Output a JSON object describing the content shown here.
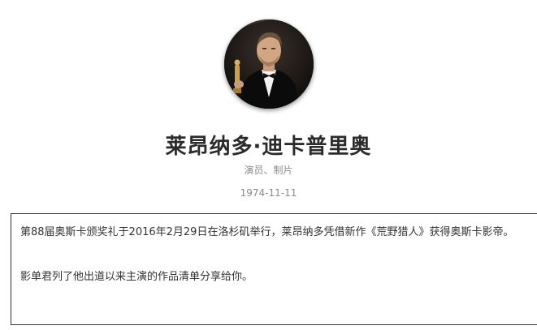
{
  "profile": {
    "avatar_icon": "person-portrait-icon",
    "name": "莱昂纳多·迪卡普里奥",
    "roles": "演员、制片",
    "birth_date": "1974-11-11"
  },
  "bio": {
    "paragraph_1": "第88届奥斯卡颁奖礼于2016年2月29日在洛杉矶举行，莱昂纳多凭借新作《荒野猎人》获得奥斯卡影帝。",
    "paragraph_2": "影单君列了他出道以来主演的作品清单分享给你。"
  },
  "colors": {
    "name_text": "#2b2b2b",
    "meta_text": "#8a8a8a",
    "bio_border": "#333333"
  }
}
